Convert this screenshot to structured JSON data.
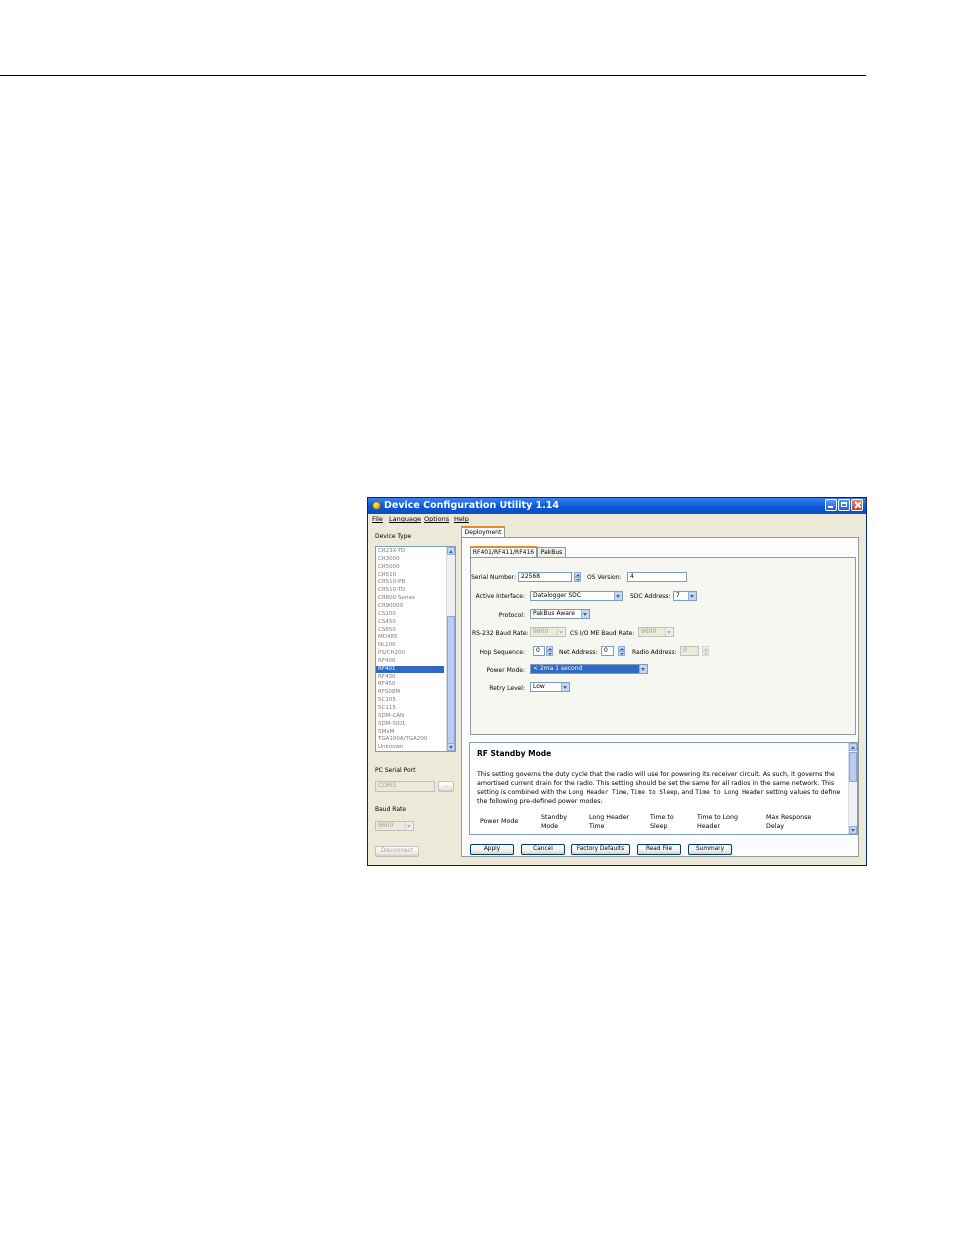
{
  "window": {
    "title": "Device Configuration Utility 1.14"
  },
  "menu": {
    "file": "File",
    "language": "Language",
    "options": "Options",
    "help": "Help"
  },
  "sidebar": {
    "device_type_label": "Device Type",
    "devices": [
      "CR23X-TD",
      "CR3000",
      "CR5000",
      "CR510",
      "CR510-PB",
      "CR510-TD",
      "CR800 Series",
      "CR9000X",
      "CS100",
      "CS450",
      "CS650",
      "MD485",
      "NL100",
      "PS/CH200",
      "RF400",
      "RF401",
      "RF430",
      "RF450",
      "RFS08M",
      "SC105",
      "SC115",
      "SDM-CAN",
      "SDM-SIO1",
      "SMxM",
      "TGA100A/TGA200",
      "Unknown"
    ],
    "selected_device": "RF401",
    "serial_port_label": "PC Serial Port",
    "serial_port_value": "COM3",
    "browse_label": "...",
    "baud_label": "Baud Rate",
    "baud_value": "9600",
    "disconnect_label": "Disconnect"
  },
  "tabs": {
    "outer": "Deployment",
    "inner": [
      "RF401/RF411/RF416",
      "PakBus"
    ]
  },
  "form": {
    "serial_number_label": "Serial Number:",
    "serial_number_value": "22568",
    "os_version_label": "OS Version:",
    "os_version_value": "4",
    "active_interface_label": "Active Interface:",
    "active_interface_value": "Datalogger SDC",
    "sdc_address_label": "SDC Address:",
    "sdc_address_value": "7",
    "protocol_label": "Protocol:",
    "protocol_value": "PakBus Aware",
    "rs232_baud_label": "RS-232 Baud Rate:",
    "rs232_baud_value": "9600",
    "csio_baud_label": "CS I/O ME Baud Rate:",
    "csio_baud_value": "9600",
    "hop_sequence_label": "Hop Sequence:",
    "hop_sequence_value": "0",
    "net_address_label": "Net Address:",
    "net_address_value": "0",
    "radio_address_label": "Radio Address:",
    "radio_address_value": "0",
    "power_mode_label": "Power Mode:",
    "power_mode_value": "< 2ma  1  second",
    "retry_level_label": "Retry Level:",
    "retry_level_value": "Low"
  },
  "help": {
    "title": "RF Standby Mode",
    "p1": "This setting governs the duty cycle that the radio will use for powering its receiver circuit. As such, it governs the amortised current drain for the radio. This setting should be set the same for all radios in the same network. This setting is combined with the ",
    "m1": "Long Header Time",
    "c1": ", ",
    "m2": "Time to Sleep",
    "c2": ", and ",
    "m3": "Time to Long Header",
    "p2": " setting values to define the following pre-defined power modes:",
    "columns": [
      "Power Mode",
      "Standby Mode",
      "Long Header Time",
      "Time to Sleep",
      "Time to Long Header",
      "Max Response Delay"
    ]
  },
  "buttons": {
    "apply": "Apply",
    "cancel": "Cancel",
    "factory_defaults": "Factory Defaults",
    "read_file": "Read File",
    "summary": "Summary"
  }
}
